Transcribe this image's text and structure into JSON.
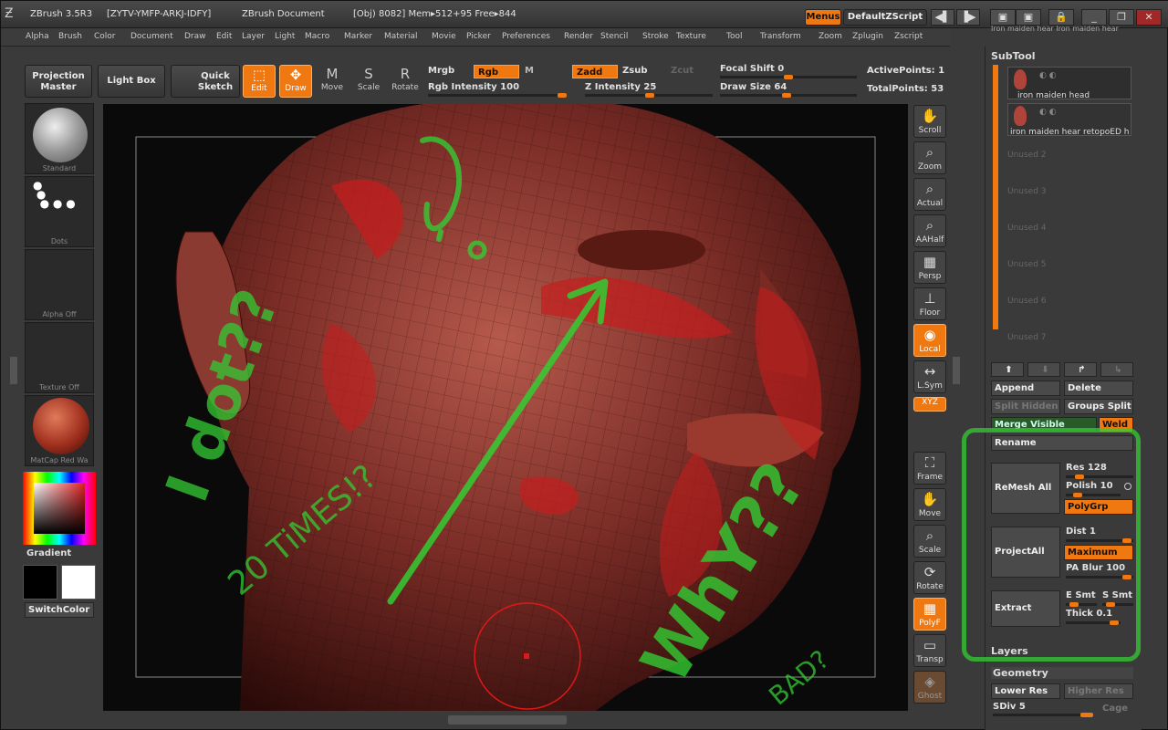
{
  "titlebar": {
    "app_version": "ZBrush 3.5R3",
    "serial": "[ZYTV-YMFP-ARKJ-IDFY]",
    "document": "ZBrush Document",
    "stats": "[Obj) 8082] Mem▸512+95 Free▸844",
    "menus_label": "Menus",
    "script_label": "DefaultZScript"
  },
  "menubar": [
    "Alpha",
    "Brush",
    "Color",
    "Document",
    "Draw",
    "Edit",
    "Layer",
    "Light",
    "Macro",
    "Marker",
    "Material",
    "Movie",
    "Picker",
    "Preferences",
    "Render",
    "Stencil",
    "Stroke",
    "Texture",
    "Tool",
    "Transform",
    "Zoom",
    "Zplugin",
    "Zscript"
  ],
  "toolbar": {
    "projection_master": "Projection Master",
    "light_box": "Light Box",
    "quick_sketch": "Quick Sketch",
    "modes": [
      {
        "label": "Edit",
        "icon": "edit-icon",
        "on": true
      },
      {
        "label": "Draw",
        "icon": "draw-icon",
        "on": true
      },
      {
        "label": "Move",
        "icon": "move-icon",
        "on": false
      },
      {
        "label": "Scale",
        "icon": "scale-icon",
        "on": false
      },
      {
        "label": "Rotate",
        "icon": "rotate-icon",
        "on": false
      }
    ],
    "mrgb": "Mrgb",
    "rgb": "Rgb",
    "m": "M",
    "zadd": "Zadd",
    "zsub": "Zsub",
    "zcut": "Zcut",
    "rgb_intensity_label": "Rgb Intensity 100",
    "rgb_intensity": 100,
    "z_intensity_label": "Z Intensity 25",
    "z_intensity": 25,
    "focal_shift_label": "Focal Shift 0",
    "draw_size_label": "Draw Size 64",
    "active_points": "ActivePoints: 1",
    "total_points": "TotalPoints: 53"
  },
  "left_shelf": {
    "brush": "Standard",
    "stroke": "Dots",
    "alpha": "Alpha Off",
    "texture": "Texture Off",
    "material": "MatCap Red Wa",
    "gradient": "Gradient",
    "switch_color": "SwitchColor"
  },
  "right_shelf": [
    {
      "label": "Scroll",
      "icon": "hand-icon",
      "on": false
    },
    {
      "label": "Zoom",
      "icon": "zoom-icon",
      "on": false
    },
    {
      "label": "Actual",
      "icon": "actual-icon",
      "on": false
    },
    {
      "label": "AAHalf",
      "icon": "aahalf-icon",
      "on": false
    },
    {
      "label": "Persp",
      "icon": "persp-icon",
      "on": false
    },
    {
      "label": "Floor",
      "icon": "floor-icon",
      "on": false
    },
    {
      "label": "Local",
      "icon": "local-icon",
      "on": true
    },
    {
      "label": "L.Sym",
      "icon": "lsym-icon",
      "on": false
    },
    {
      "label": "XYZ",
      "icon": "xyz-icon",
      "on": true
    },
    {
      "label": "Frame",
      "icon": "frame-icon",
      "on": false
    },
    {
      "label": "Move",
      "icon": "move-icon",
      "on": false
    },
    {
      "label": "Scale",
      "icon": "scale-icon",
      "on": false
    },
    {
      "label": "Rotate",
      "icon": "rotate-icon",
      "on": false
    },
    {
      "label": "PolyF",
      "icon": "polyf-icon",
      "on": true
    },
    {
      "label": "Transp",
      "icon": "transp-icon",
      "on": false
    },
    {
      "label": "Ghost",
      "icon": "ghost-icon",
      "on": false
    }
  ],
  "tray": {
    "top_names": [
      "Iron  maiden  hear Iron  maiden  hear"
    ],
    "subtool_title": "SubTool",
    "subtools": [
      "iron  maiden  head",
      "iron  maiden  hear  retopoED  h"
    ],
    "unused": [
      "Unused  2",
      "Unused  3",
      "Unused  4",
      "Unused  5",
      "Unused  6",
      "Unused  7"
    ],
    "append": "Append",
    "delete": "Delete",
    "split_hidden": "Split Hidden",
    "groups_split": "Groups Split",
    "merge_visible": "Merge Visible",
    "weld": "Weld",
    "rename": "Rename",
    "remesh_all": "ReMesh  All",
    "res_label": "Res 128",
    "polish_label": "Polish 10",
    "polygrp": "PolyGrp",
    "project_all": "ProjectAll",
    "dist_label": "Dist 1",
    "maximum": "Maximum",
    "pa_blur_label": "PA Blur 100",
    "extract": "Extract",
    "e_smt": "E Smt",
    "s_smt": "S Smt",
    "thick_label": "Thick 0.1",
    "layers": "Layers",
    "geometry": "Geometry",
    "lower_res": "Lower Res",
    "higher_res": "Higher Res",
    "sdiv_label": "SDiv 5",
    "cage": "Cage"
  },
  "annotations": {
    "text1": "I dot??",
    "text2": "20 TiMES!?",
    "text3": "WhY??",
    "text4": "BAD?",
    "color": "#33cc33"
  },
  "colors": {
    "accent": "#f07810",
    "skin": "#8a3530",
    "polygroup": "#c41e1e"
  }
}
